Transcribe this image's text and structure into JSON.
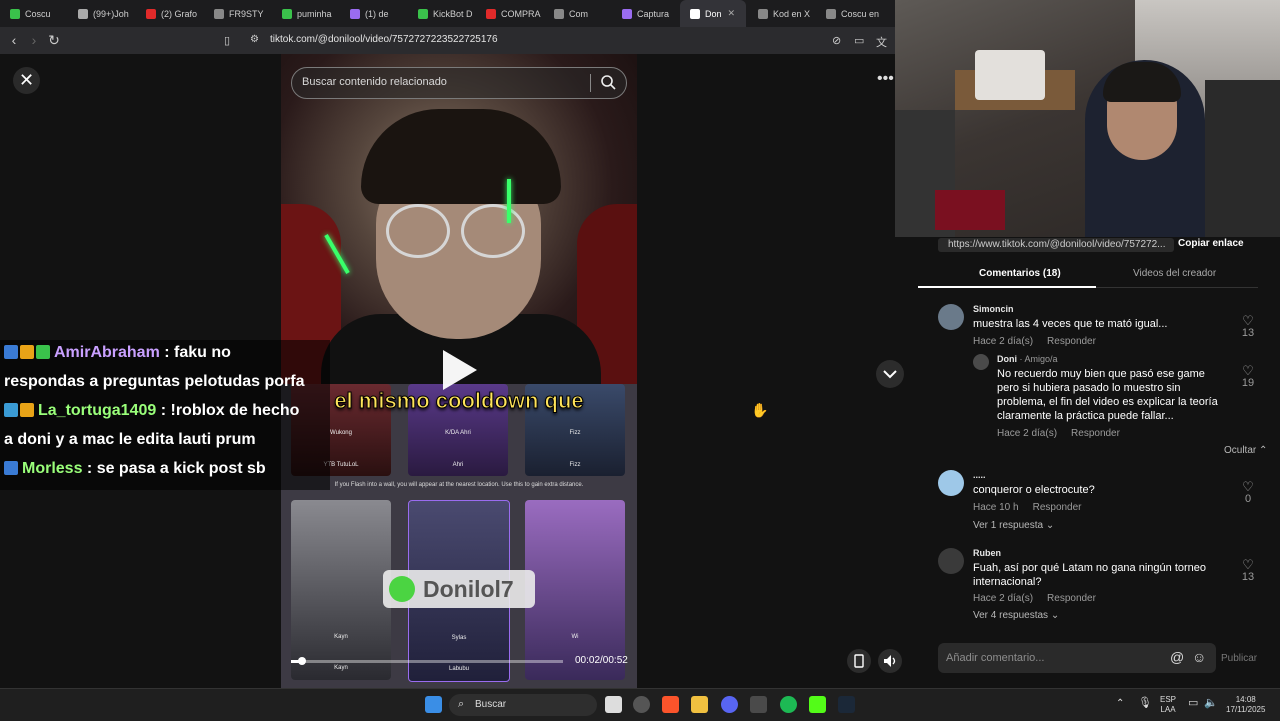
{
  "browser": {
    "tabs": [
      {
        "label": "Coscu",
        "color": "#3ac24b"
      },
      {
        "label": "(99+)Joh",
        "color": "#aaa"
      },
      {
        "label": "(2) Grafo",
        "color": "#e02a2a"
      },
      {
        "label": "FR9STY",
        "color": "#888"
      },
      {
        "label": "puminha",
        "color": "#3ac24b"
      },
      {
        "label": "(1) de",
        "color": "#9a6cf0"
      },
      {
        "label": "KickBot D",
        "color": "#3ac24b"
      },
      {
        "label": "COMPRA",
        "color": "#e02a2a"
      },
      {
        "label": "Com",
        "color": "#888"
      },
      {
        "label": "Captura",
        "color": "#9a6cf0"
      },
      {
        "label": "Don",
        "color": "#fff"
      },
      {
        "label": "Kod en X",
        "color": "#888"
      },
      {
        "label": "Coscu en",
        "color": "#888"
      }
    ],
    "url": "tiktok.com/@donilool/video/7572727223522725176"
  },
  "video": {
    "search_placeholder": "Buscar contenido relacionado",
    "caption": "el mismo cooldown que",
    "card_names_top": [
      "Wukong",
      "K/DA Ahri",
      "Fizz"
    ],
    "card_owners_top": [
      "YTB TutuLoL",
      "Ahri",
      "Fizz"
    ],
    "flash_note": "If you Flash into a wall, you will appear at the nearest location. Use this to gain extra distance.",
    "card_names_bottom": [
      "Kayn",
      "Sylas",
      "Wi"
    ],
    "card_owners_bottom": [
      "Kayn",
      "Labubu",
      ""
    ],
    "watermark": "Donilol7",
    "time": "00:02/00:52",
    "progress": 0.04
  },
  "chat": [
    {
      "user": "AmirAbraham",
      "user_color": "#c9a0ff",
      "message": " : faku no",
      "badges": [
        "#3a7bd5",
        "#e8a317",
        "#3ac24b"
      ]
    },
    {
      "user": "",
      "user_color": "#fff",
      "message": "respondas a preguntas pelotudas porfa",
      "badges": []
    },
    {
      "user": "La_tortuga1409",
      "user_color": "#9aff7a",
      "message": " : !roblox de hecho",
      "badges": [
        "#3a9bd5",
        "#e8a317"
      ]
    },
    {
      "user": "",
      "user_color": "#fff",
      "message": "a doni y a mac le edita lauti prum",
      "badges": []
    },
    {
      "user": "Morless",
      "user_color": "#9aff7a",
      "message": " : se pasa a kick post sb",
      "badges": [
        "#3a7bd5"
      ]
    }
  ],
  "panel": {
    "share_url": "https://www.tiktok.com/@donilool/video/757272...",
    "copy_label": "Copiar enlace",
    "tab_comments": "Comentarios (18)",
    "tab_videos": "Videos del creador",
    "comments": [
      {
        "user": "Simoncin",
        "meta": "",
        "text": "muestra las 4 veces que te mató igual...",
        "date": "Hace 2 día(s)",
        "reply": "Responder",
        "likes": "13",
        "avatar_color": "#6a7a8a"
      },
      {
        "user": "Doni",
        "meta": " · Amigo/a",
        "text": "No recuerdo muy bien que pasó ese game pero si hubiera pasado lo muestro sin problema, el fin del video es explicar la teoría claramente la práctica puede fallar...",
        "date": "Hace 2 día(s)",
        "reply": "Responder",
        "likes": "19",
        "avatar_color": "#4a4a4a"
      },
      {
        "user": ".....",
        "meta": "",
        "text": "conqueror o electrocute?",
        "date": "Hace 10 h",
        "reply": "Responder",
        "likes": "0",
        "avatar_color": "#9ec8e8"
      },
      {
        "user": "Ruben",
        "meta": "",
        "text": "Fuah, así por qué Latam no gana ningún torneo internacional?",
        "date": "Hace 2 día(s)",
        "reply": "Responder",
        "likes": "13",
        "avatar_color": "#3a3a3a"
      }
    ],
    "hide_label": "Ocultar",
    "view_replies_1": "Ver 1 respuesta",
    "view_replies_4": "Ver 4 respuestas",
    "input_placeholder": "Añadir comentario...",
    "publish_label": "Publicar"
  },
  "taskbar": {
    "search_label": "Buscar",
    "lang": "ESP",
    "lang2": "LAA",
    "time": "14:08",
    "date": "17/11/2025"
  }
}
